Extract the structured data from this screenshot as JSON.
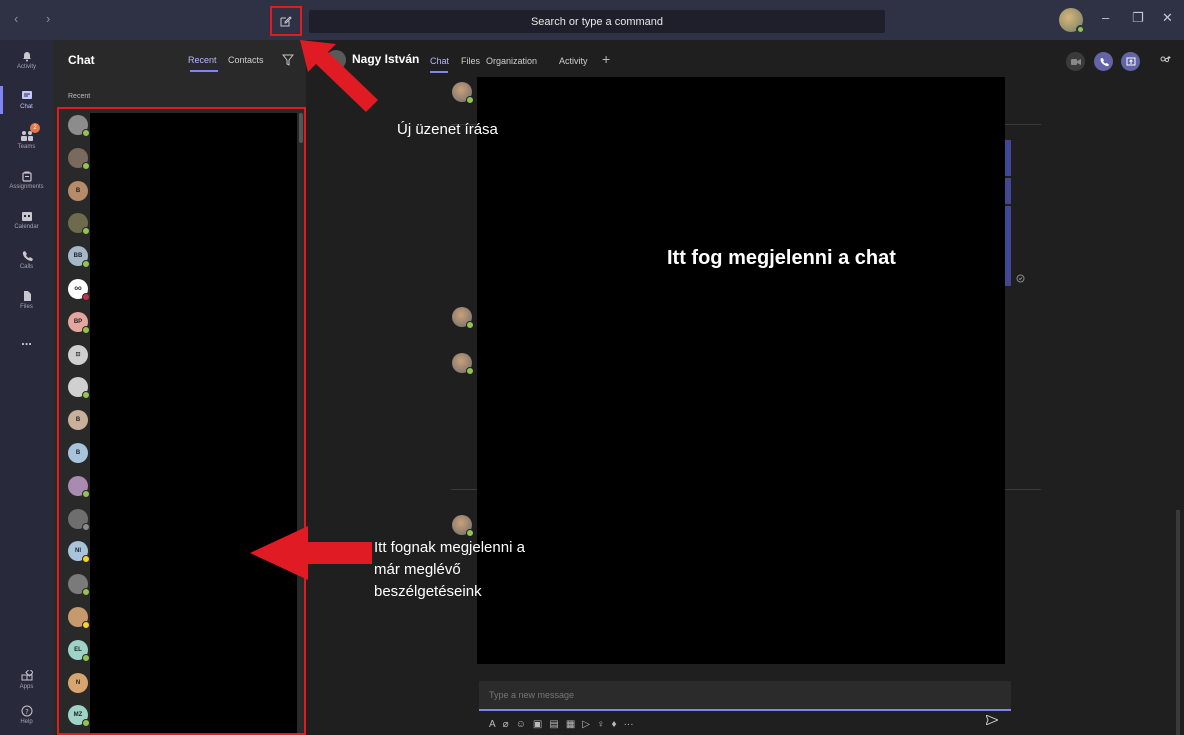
{
  "titlebar": {
    "nav": "‹ ›",
    "search_placeholder": "Search or type a command",
    "window_controls": [
      "–",
      "❐",
      "✕"
    ]
  },
  "rail": {
    "items": [
      {
        "label": "Activity",
        "icon": "bell-icon"
      },
      {
        "label": "Chat",
        "icon": "chat-icon",
        "active": true
      },
      {
        "label": "Teams",
        "icon": "teams-icon",
        "badge": "2"
      },
      {
        "label": "Assignments",
        "icon": "assignments-icon"
      },
      {
        "label": "Calendar",
        "icon": "calendar-icon"
      },
      {
        "label": "Calls",
        "icon": "phone-icon"
      },
      {
        "label": "Files",
        "icon": "files-icon"
      },
      {
        "label": "...",
        "icon": "more-icon"
      }
    ],
    "apps_label": "Apps",
    "help_label": "Help"
  },
  "chat_list": {
    "title": "Chat",
    "tab_recent": "Recent",
    "tab_contacts": "Contacts",
    "section_label": "Recent",
    "avatars": [
      {
        "initials": "",
        "bg": "#8c8c8c",
        "status": "#92c353"
      },
      {
        "initials": "",
        "bg": "#7a6a5e",
        "status": "#92c353"
      },
      {
        "initials": "B",
        "bg": "#b58b6a",
        "status": ""
      },
      {
        "initials": "",
        "bg": "#6e6a4e",
        "status": "#92c353"
      },
      {
        "initials": "BB",
        "bg": "#a3b8c8",
        "status": "#92c353"
      },
      {
        "initials": "oo",
        "bg": "#ffffff",
        "status": "#c4314b"
      },
      {
        "initials": "BP",
        "bg": "#e6a6a0",
        "status": "#92c353"
      },
      {
        "initials": "⊡",
        "bg": "#cfcfcf",
        "status": ""
      },
      {
        "initials": "",
        "bg": "#d0d0d0",
        "status": "#92c353"
      },
      {
        "initials": "B",
        "bg": "#c8b09a",
        "status": ""
      },
      {
        "initials": "B",
        "bg": "#a8c4dc",
        "status": ""
      },
      {
        "initials": "",
        "bg": "#a98ab0",
        "status": "#92c353"
      },
      {
        "initials": "",
        "bg": "#6e6e6e",
        "status": "#8a8a8a"
      },
      {
        "initials": "NI",
        "bg": "#a8c4dc",
        "status": "#f8d22a"
      },
      {
        "initials": "",
        "bg": "#7a7a7a",
        "status": "#92c353"
      },
      {
        "initials": "",
        "bg": "#c79a6e",
        "status": "#f8d22a"
      },
      {
        "initials": "EL",
        "bg": "#9fd3c7",
        "status": "#92c353"
      },
      {
        "initials": "N",
        "bg": "#d9a56e",
        "status": ""
      },
      {
        "initials": "MZ",
        "bg": "#9fd3c7",
        "status": "#92c353"
      }
    ]
  },
  "main": {
    "contact_name": "Nagy István",
    "tabs": [
      "Chat",
      "Files",
      "Organization",
      "Activity"
    ],
    "placeholder_text": "Itt fog megjelenni a chat",
    "compose_placeholder": "Type a new message",
    "toolbar_icons": [
      "A",
      "⌀",
      "☺",
      "▣",
      "▤",
      "▦",
      "▷",
      "♀",
      "♦",
      "···"
    ]
  },
  "annotations": {
    "new_message": "Új üzenet írása",
    "conversations_line1": "Itt fognak megjelenni a",
    "conversations_line2": "már meglévő",
    "conversations_line3": "beszélgetéseink"
  },
  "colors": {
    "accent": "#7f85f5",
    "annotation_red": "#e01b24",
    "available": "#92c353",
    "away": "#f8d22a",
    "busy": "#c4314b"
  }
}
